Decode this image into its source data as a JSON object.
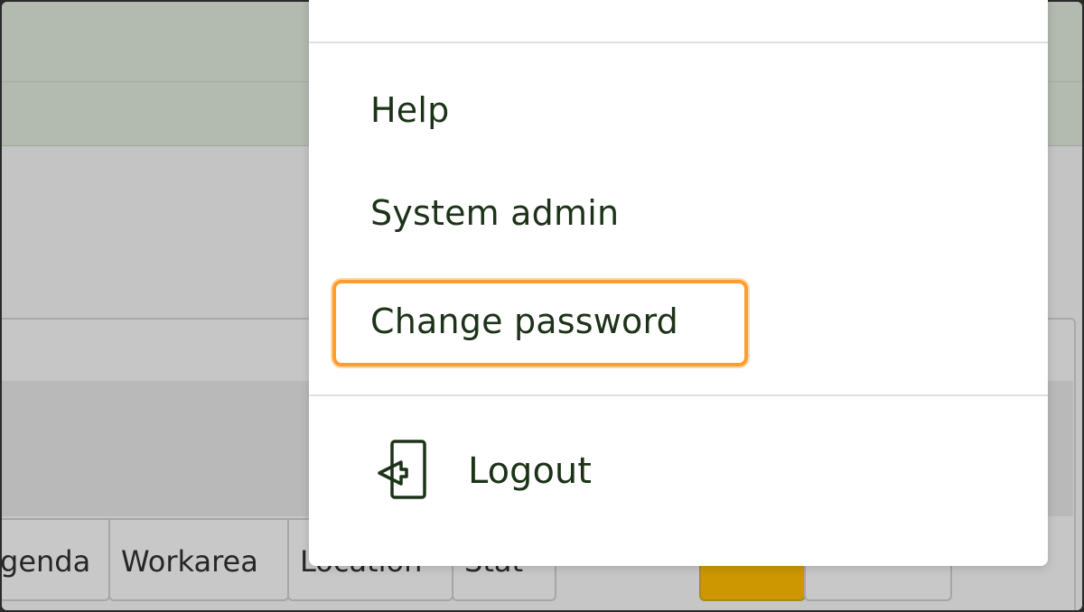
{
  "background_tabs": [
    {
      "label": "genda"
    },
    {
      "label": "Workarea"
    },
    {
      "label": "Location"
    },
    {
      "label": "Stat"
    },
    {
      "label": ""
    },
    {
      "label": ""
    }
  ],
  "menu": {
    "items": [
      {
        "label": "Help"
      },
      {
        "label": "System admin"
      },
      {
        "label": "Change password"
      }
    ],
    "logout": {
      "label": "Logout",
      "icon": "logout-icon"
    }
  },
  "colors": {
    "menu_text": "#1c3318",
    "focus_ring": "#ff9d2e",
    "header_bg": "#b3bab0",
    "active_tab": "#cc9700"
  }
}
